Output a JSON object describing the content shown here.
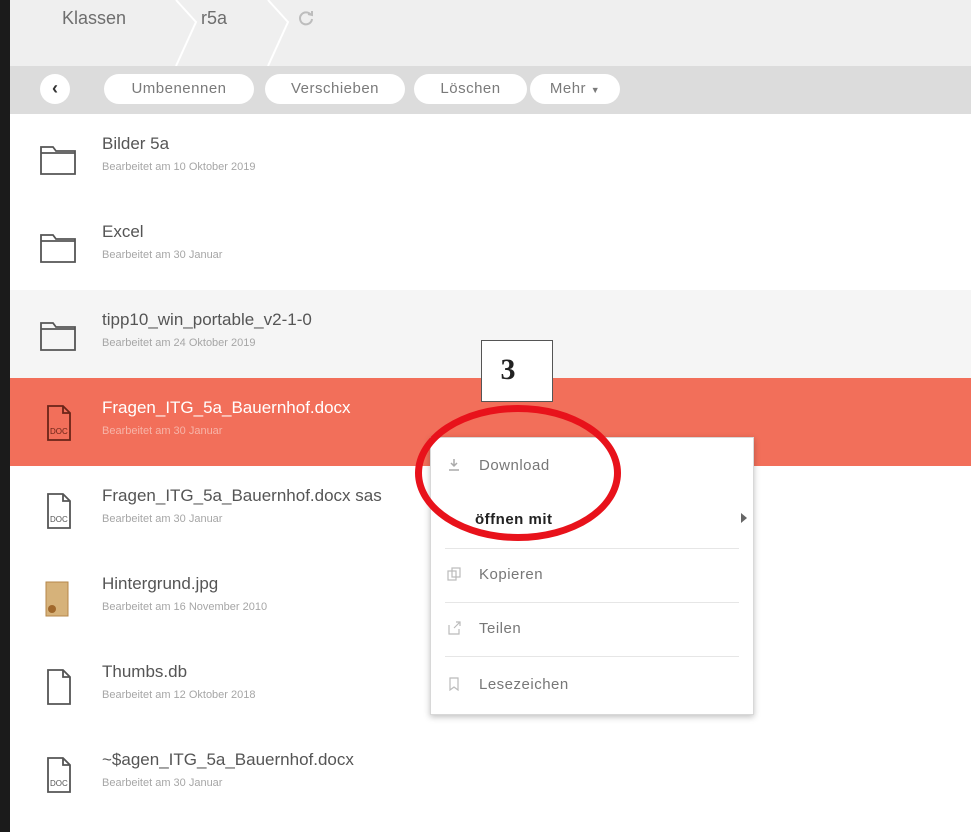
{
  "breadcrumbs": [
    "Klassen",
    "r5a"
  ],
  "toolbar": {
    "rename": "Umbenennen",
    "move": "Verschieben",
    "delete": "Löschen",
    "more": "Mehr"
  },
  "files": [
    {
      "name": "Bilder 5a",
      "meta": "Bearbeitet am 10 Oktober 2019",
      "icon": "folder-icon"
    },
    {
      "name": "Excel",
      "meta": "Bearbeitet am 30 Januar",
      "icon": "folder-icon"
    },
    {
      "name": "tipp10_win_portable_v2-1-0",
      "meta": "Bearbeitet am 24 Oktober 2019",
      "icon": "folder-icon"
    },
    {
      "name": "Fragen_ITG_5a_Bauernhof.docx",
      "meta": "Bearbeitet am 30 Januar",
      "icon": "doc-icon"
    },
    {
      "name": "Fragen_ITG_5a_Bauernhof.docx sas",
      "meta": "Bearbeitet am 30 Januar",
      "icon": "doc-icon"
    },
    {
      "name": "Hintergrund.jpg",
      "meta": "Bearbeitet am 16 November 2010",
      "icon": "image-thumbnail-icon"
    },
    {
      "name": "Thumbs.db",
      "meta": "Bearbeitet am 12 Oktober 2018",
      "icon": "file-icon"
    },
    {
      "name": "~$agen_ITG_5a_Bauernhof.docx",
      "meta": "Bearbeitet am 30 Januar",
      "icon": "doc-icon"
    }
  ],
  "context_menu": {
    "download": "Download",
    "open_with": "öffnen mit",
    "copy": "Kopieren",
    "share": "Teilen",
    "bookmark": "Lesezeichen"
  },
  "annotation": {
    "step": "3",
    "highlight_color": "#e8121b"
  },
  "colors": {
    "selected_row": "#f26f5a",
    "toolbar": "#dcdcdc"
  }
}
